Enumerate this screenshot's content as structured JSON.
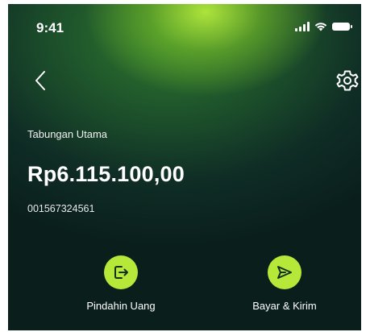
{
  "status_bar": {
    "time": "9:41"
  },
  "account": {
    "name": "Tabungan Utama",
    "balance": "Rp6.115.100,00",
    "number": "001567324561"
  },
  "actions": [
    {
      "label": "Pindahin Uang",
      "icon": "transfer-out-icon"
    },
    {
      "label": "Bayar & Kirim",
      "icon": "send-icon"
    }
  ],
  "colors": {
    "accent": "#b6e83a",
    "background_dark": "#0f2c25"
  }
}
